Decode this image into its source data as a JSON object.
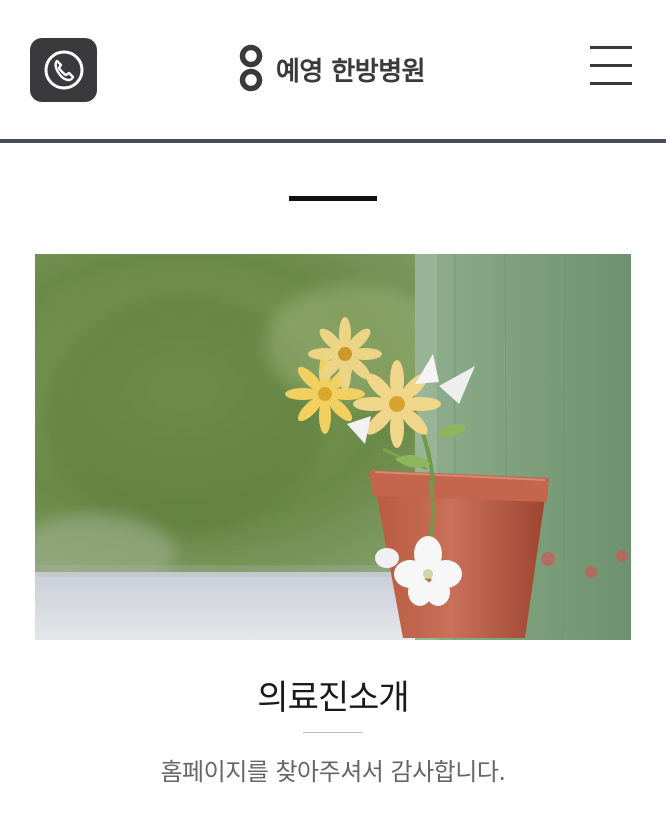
{
  "header": {
    "logo_text": "예영 한방병원",
    "call_icon": "phone-icon",
    "menu_icon": "hamburger-menu-icon",
    "bg_color": "#ffffff",
    "accent_line_color": "#4a4e5c",
    "icon_color": "#3a3a3c"
  },
  "hero": {
    "image": "flower-pot-photo"
  },
  "section": {
    "title": "의료진소개",
    "subtitle": "홈페이지를 찾아주셔서 감사합니다."
  }
}
